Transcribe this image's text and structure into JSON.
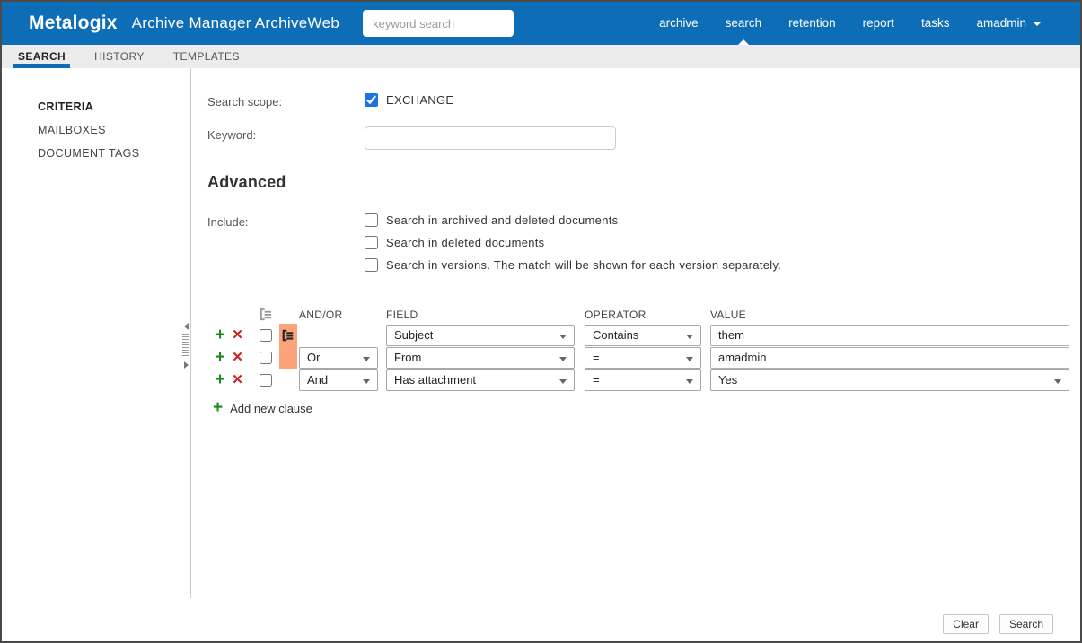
{
  "header": {
    "logo": "Metalogix",
    "app_title": "Archive Manager ArchiveWeb",
    "search_placeholder": "keyword search",
    "nav": [
      {
        "label": "archive",
        "active": false
      },
      {
        "label": "search",
        "active": true
      },
      {
        "label": "retention",
        "active": false
      },
      {
        "label": "report",
        "active": false
      },
      {
        "label": "tasks",
        "active": false
      }
    ],
    "user": {
      "label": "amadmin"
    }
  },
  "tabs": [
    {
      "label": "SEARCH",
      "active": true
    },
    {
      "label": "HISTORY",
      "active": false
    },
    {
      "label": "TEMPLATES",
      "active": false
    }
  ],
  "sidebar": {
    "items": [
      {
        "label": "CRITERIA",
        "active": true
      },
      {
        "label": "MAILBOXES",
        "active": false
      },
      {
        "label": "DOCUMENT TAGS",
        "active": false
      }
    ]
  },
  "main": {
    "search_scope_label": "Search scope:",
    "scope": {
      "label": "EXCHANGE",
      "checked": true
    },
    "keyword_label": "Keyword:",
    "keyword_value": "",
    "advanced_heading": "Advanced",
    "include_label": "Include:",
    "include_options": [
      {
        "label": "Search in archived and deleted documents",
        "checked": false
      },
      {
        "label": "Search in deleted documents",
        "checked": false
      },
      {
        "label": "Search in versions. The match will be shown for each version separately.",
        "checked": false
      }
    ],
    "builder": {
      "headers": {
        "andor": "AND/OR",
        "field": "FIELD",
        "operator": "OPERATOR",
        "value": "VALUE"
      },
      "rows": [
        {
          "andor": "",
          "field": "Subject",
          "operator": "Contains",
          "value": "them",
          "value_type": "text",
          "grouped": true
        },
        {
          "andor": "Or",
          "field": "From",
          "operator": "=",
          "value": "amadmin",
          "value_type": "text",
          "grouped": true
        },
        {
          "andor": "And",
          "field": "Has attachment",
          "operator": "=",
          "value": "Yes",
          "value_type": "select",
          "grouped": false
        }
      ],
      "add_clause_label": "Add new clause"
    }
  },
  "footer": {
    "clear_label": "Clear",
    "search_label": "Search"
  },
  "colors": {
    "header_blue": "#0d6db6",
    "group_highlight": "#fca37c",
    "add_green": "#1e8a1e",
    "delete_red": "#cf1d1d",
    "checkbox_blue": "#1a73e8",
    "tabbar_gray": "#ececec"
  }
}
